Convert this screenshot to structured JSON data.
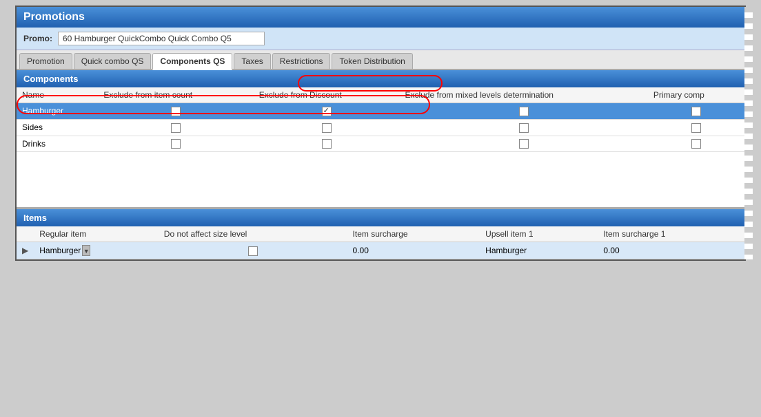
{
  "title": "Promotions",
  "promo": {
    "label": "Promo:",
    "value": "60 Hamburger QuickCombo Quick Combo Q5"
  },
  "tabs": [
    {
      "id": "promotion",
      "label": "Promotion",
      "active": false
    },
    {
      "id": "quick-combo-qs",
      "label": "Quick combo QS",
      "active": false
    },
    {
      "id": "components-qs",
      "label": "Components QS",
      "active": true
    },
    {
      "id": "taxes",
      "label": "Taxes",
      "active": false
    },
    {
      "id": "restrictions",
      "label": "Restrictions",
      "active": false
    },
    {
      "id": "token-distribution",
      "label": "Token Distribution",
      "active": false
    }
  ],
  "components": {
    "header": "Components",
    "columns": [
      "Name",
      "Exclude from item count",
      "Exclude from Discount",
      "Exclude from mixed levels determination",
      "Primary comp"
    ],
    "rows": [
      {
        "name": "Hamburger",
        "excludeFromItemCount": false,
        "excludeFromDiscount": true,
        "excludeFromMixed": false,
        "primary": false,
        "selected": true
      },
      {
        "name": "Sides",
        "excludeFromItemCount": false,
        "excludeFromDiscount": false,
        "excludeFromMixed": false,
        "primary": false,
        "selected": false
      },
      {
        "name": "Drinks",
        "excludeFromItemCount": false,
        "excludeFromDiscount": false,
        "excludeFromMixed": false,
        "primary": false,
        "selected": false
      }
    ]
  },
  "items": {
    "header": "Items",
    "columns": [
      "Regular item",
      "Do not affect size level",
      "Item surcharge",
      "Upsell item 1",
      "Item surcharge 1"
    ],
    "rows": [
      {
        "arrow": "▶",
        "regularItem": "Hamburger",
        "doNotAffect": false,
        "itemSurcharge": "0.00",
        "upsellItem1": "Hamburger",
        "itemSurcharge1": "0.00"
      }
    ]
  }
}
